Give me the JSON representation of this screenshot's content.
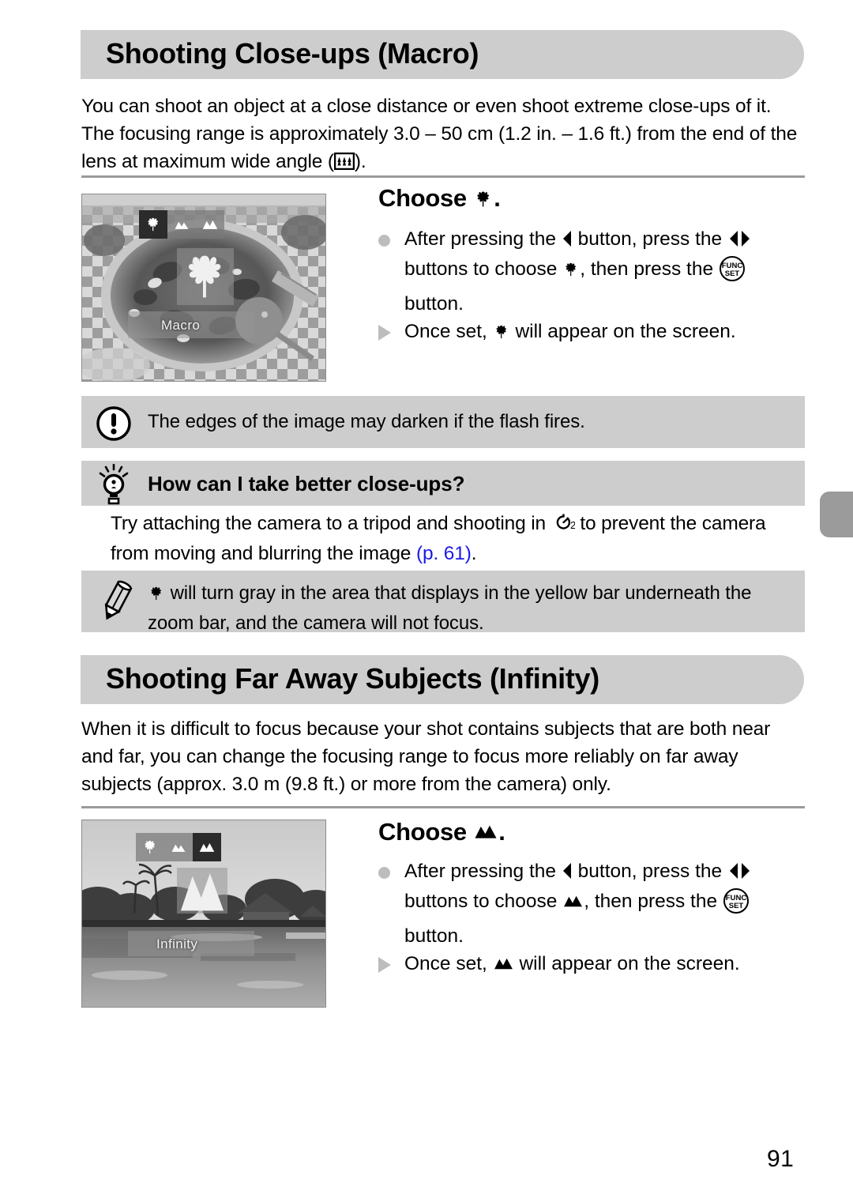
{
  "page": {
    "number": "91"
  },
  "section1": {
    "heading": "Shooting Close-ups (Macro)",
    "intro": "You can shoot an object at a close distance or even shoot extreme close-ups of it. The focusing range is approximately 3.0 – 50 cm (1.2 in. – 1.6 ft.) from the end of the lens at maximum wide angle (",
    "intro_tail": ").",
    "intro_icon": "wide-angle-icon",
    "photo": {
      "mode_label": "Macro",
      "strip_icons": [
        "macro-icon",
        "normal-focus-icon",
        "infinity-icon"
      ],
      "selected_index": 0,
      "alt": "close-up photo of a pizza on a checkered tablecloth"
    },
    "choose": {
      "label": "Choose",
      "icon": "macro-icon",
      "trailing": "."
    },
    "steps": [
      {
        "marker": "dot",
        "parts": [
          {
            "t": "text",
            "v": "After pressing the "
          },
          {
            "t": "icon",
            "v": "left-arrow-icon"
          },
          {
            "t": "text",
            "v": " button, press the "
          },
          {
            "t": "icon",
            "v": "left-right-arrows-icon"
          },
          {
            "t": "text",
            "v": " buttons to choose "
          },
          {
            "t": "icon",
            "v": "macro-icon"
          },
          {
            "t": "text",
            "v": ", then press the "
          },
          {
            "t": "icon",
            "v": "func-set-icon"
          },
          {
            "t": "text",
            "v": " button."
          }
        ]
      },
      {
        "marker": "triangle",
        "parts": [
          {
            "t": "text",
            "v": "Once set, "
          },
          {
            "t": "icon",
            "v": "macro-icon"
          },
          {
            "t": "text",
            "v": " will appear on the screen."
          }
        ]
      }
    ],
    "warning": {
      "icon": "exclamation-circle-icon",
      "text": "The edges of the image may darken if the flash fires."
    },
    "tip": {
      "icon": "lightbulb-icon",
      "title": "How can I take better close-ups?",
      "body_before": "Try attaching the camera to a tripod and shooting in ",
      "body_icon": "self-timer-2sec-icon",
      "body_middle": " to prevent the camera from moving and blurring the image ",
      "link": "(p. 61)",
      "body_after": "."
    },
    "note": {
      "icon": "pencil-icon",
      "lead_icon": "macro-icon",
      "text": " will turn gray in the area that displays in the yellow bar underneath the zoom bar, and the camera will not focus."
    }
  },
  "section2": {
    "heading": "Shooting Far Away Subjects (Infinity)",
    "intro": "When it is difficult to focus because your shot contains subjects that are both near and far, you can change the focusing range to focus more reliably on far away subjects (approx. 3.0 m (9.8 ft.) or more from the camera) only.",
    "photo": {
      "mode_label": "Infinity",
      "strip_icons": [
        "macro-icon",
        "normal-focus-icon",
        "infinity-icon"
      ],
      "selected_index": 2,
      "alt": "landscape photo of a tropical lagoon with palm trees and a hut"
    },
    "choose": {
      "label": "Choose",
      "icon": "infinity-icon",
      "trailing": "."
    },
    "steps": [
      {
        "marker": "dot",
        "parts": [
          {
            "t": "text",
            "v": "After pressing the "
          },
          {
            "t": "icon",
            "v": "left-arrow-icon"
          },
          {
            "t": "text",
            "v": " button, press the "
          },
          {
            "t": "icon",
            "v": "left-right-arrows-icon"
          },
          {
            "t": "text",
            "v": " buttons to choose "
          },
          {
            "t": "icon",
            "v": "infinity-icon"
          },
          {
            "t": "text",
            "v": ", then press the "
          },
          {
            "t": "icon",
            "v": "func-set-icon"
          },
          {
            "t": "text",
            "v": " button."
          }
        ]
      },
      {
        "marker": "triangle",
        "parts": [
          {
            "t": "text",
            "v": "Once set, "
          },
          {
            "t": "icon",
            "v": "infinity-icon"
          },
          {
            "t": "text",
            "v": " will appear on the screen."
          }
        ]
      }
    ]
  },
  "colors": {
    "bar_gray": "#cdcdcd",
    "rule_gray": "#9a9a9a",
    "bullet_gray": "#bdbdbd",
    "link_blue": "#1a1ae6",
    "edge_tab_gray": "#9b9b9b"
  }
}
